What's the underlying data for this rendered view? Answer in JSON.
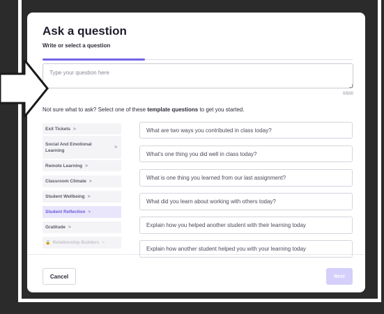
{
  "modal": {
    "title": "Ask a question",
    "subtitle": "Write or select a question",
    "input_placeholder": "Type your question here",
    "char_count": "0/500",
    "progress_fraction": 0.33
  },
  "helper": {
    "prefix": "Not sure what to ask? Select one of these ",
    "bold": "template questions",
    "suffix": " to get you started."
  },
  "categories": [
    {
      "label": "Exit Tickets",
      "chevron": ">"
    },
    {
      "label": "Social And Emotional Learning",
      "chevron": ">"
    },
    {
      "label": "Remote Learning",
      "chevron": ">"
    },
    {
      "label": "Classroom Climate",
      "chevron": ">"
    },
    {
      "label": "Student Wellbeing",
      "chevron": ">"
    },
    {
      "label": "Student Reflection",
      "chevron": ">",
      "active": true
    },
    {
      "label": "Gratitude",
      "chevron": ">"
    },
    {
      "label": "Relationship Builders",
      "chevron": ">",
      "locked": true
    }
  ],
  "questions": [
    "What are two ways you contributed in class today?",
    "What's one thing you did well in class today?",
    "What is one thing you learned from our last assignment?",
    "What did you learn about working with others today?",
    "Explain how you helped another student with their learning today",
    "Explain how another student helped you with your learning today"
  ],
  "footer": {
    "cancel_label": "Cancel",
    "next_label": "Next"
  },
  "colors": {
    "accent": "#7265e6",
    "active_category_bg": "#e9e6fc",
    "next_disabled": "#d4cffb",
    "backdrop": "#2b2b2b"
  },
  "icons": [
    "pointer-arrow-icon",
    "lock-icon",
    "chevron-right-icon",
    "resize-grip-icon"
  ]
}
